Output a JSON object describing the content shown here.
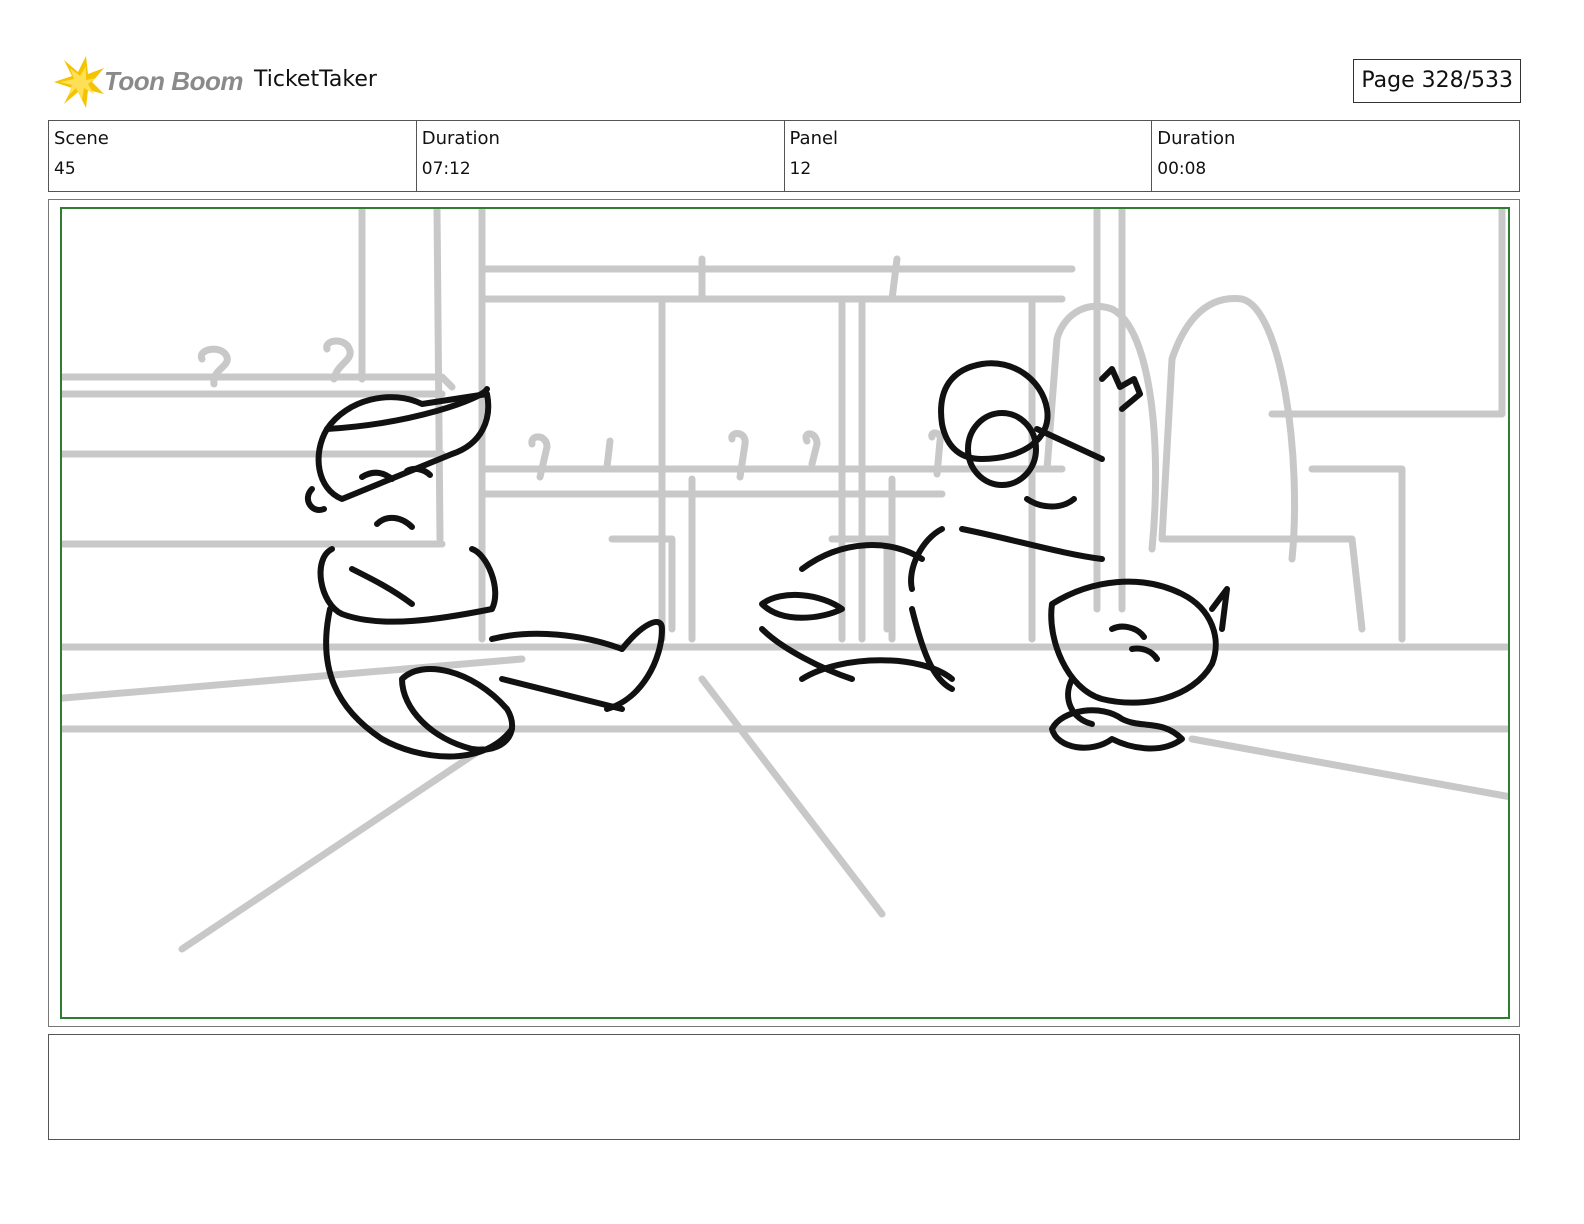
{
  "header": {
    "logo_text": "Toon Boom",
    "project_title": "TicketTaker",
    "page_number": "Page 328/533"
  },
  "info": {
    "scene_label": "Scene",
    "scene_value": "45",
    "scene_duration_label": "Duration",
    "scene_duration_value": "07:12",
    "panel_label": "Panel",
    "panel_value": "12",
    "panel_duration_label": "Duration",
    "panel_duration_value": "00:08"
  },
  "panel": {
    "image_description_icon": "storyboard-sketch",
    "frame_color": "#2e7d32"
  },
  "notes": {
    "text": ""
  },
  "colors": {
    "logo_star": "#f5c400",
    "logo_text": "#8a8a8a",
    "background_lines": "#c8c8c8",
    "character_lines": "#111111"
  }
}
